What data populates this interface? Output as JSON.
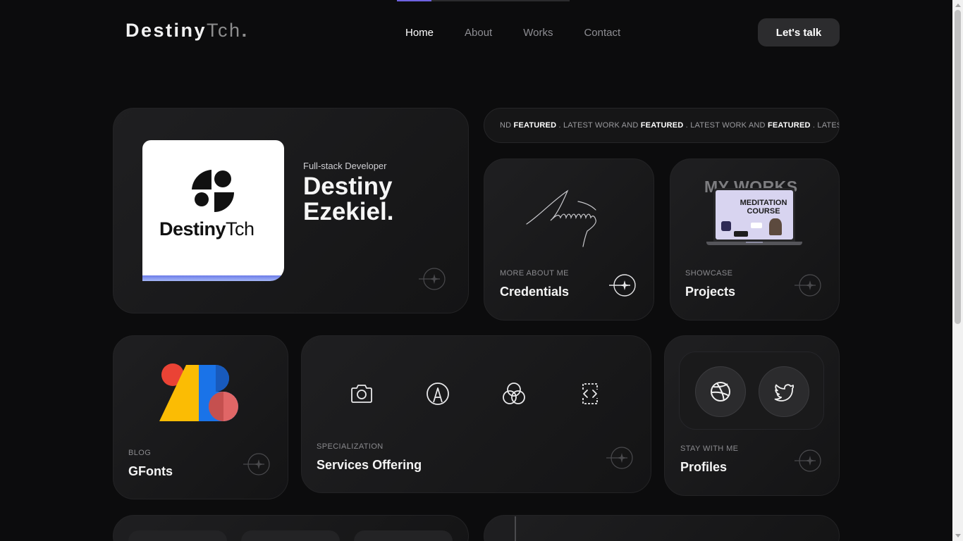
{
  "brand": {
    "name_bold": "Destiny",
    "name_light": "Tch",
    "name_dot": "."
  },
  "nav": {
    "items": [
      "Home",
      "About",
      "Works",
      "Contact"
    ],
    "active": "Home"
  },
  "cta": {
    "label": "Let's talk"
  },
  "page_progress_fraction": 0.2,
  "hero": {
    "subtitle": "Full-stack Developer",
    "name_line1": "Destiny",
    "name_line2": "Ezekiel.",
    "image_brand_bold": "Destiny",
    "image_brand_light": "Tch"
  },
  "marquee": {
    "segments": [
      {
        "text": "ND ",
        "bold": false
      },
      {
        "text": "FEATURED",
        "bold": true
      },
      {
        "text": " . LATEST WORK AND ",
        "bold": false
      },
      {
        "text": "FEATURED",
        "bold": true
      },
      {
        "text": " . LATEST WORK AND ",
        "bold": false
      },
      {
        "text": "FEATURED",
        "bold": true
      },
      {
        "text": " . LATEST",
        "bold": false
      }
    ]
  },
  "credentials": {
    "label": "MORE ABOUT ME",
    "title": "Credentials"
  },
  "projects": {
    "label": "SHOWCASE",
    "title": "Projects",
    "image_heading": "MY WORKS",
    "laptop_text_line1": "MEDITATION",
    "laptop_text_line2": "COURSE"
  },
  "gfonts": {
    "label": "BLOG",
    "title": "GFonts"
  },
  "services": {
    "label": "SPECIALIZATION",
    "title": "Services Offering",
    "icons": [
      "camera-icon",
      "pen-tool-icon",
      "color-circles-icon",
      "code-brackets-icon"
    ]
  },
  "profiles": {
    "label": "STAY WITH ME",
    "title": "Profiles",
    "icons": [
      "dribbble-icon",
      "twitter-icon"
    ]
  },
  "colors": {
    "background": "#0c0c0d",
    "accent": "#6e62e0",
    "card": "#1c1c1e"
  }
}
